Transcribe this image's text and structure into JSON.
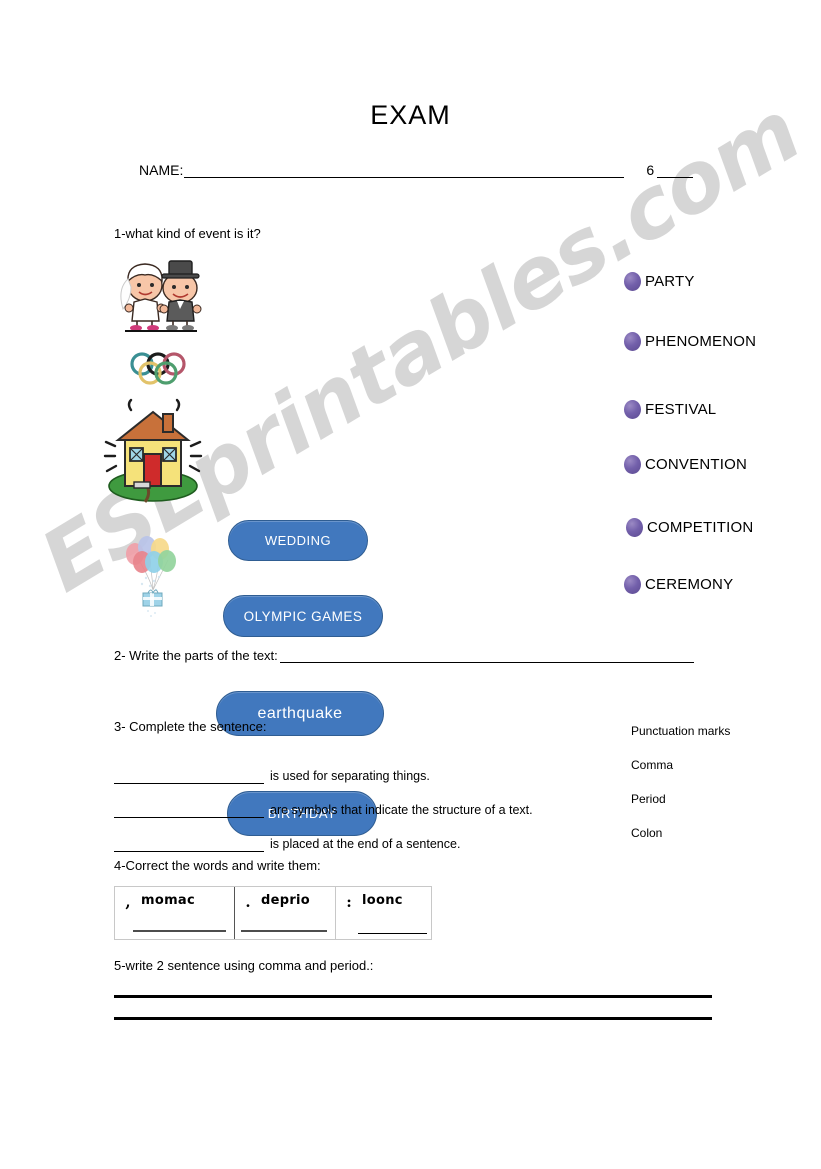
{
  "header": {
    "title": "EXAM",
    "name_label": "NAME:",
    "grade_label": "6"
  },
  "q1": {
    "prompt": "1-what kind of event is it?",
    "items": [
      {
        "image": "wedding-couple-clipart",
        "button_label": "WEDDING"
      },
      {
        "image": "olympic-rings-clipart",
        "button_label": "OLYMPIC GAMES"
      },
      {
        "image": "shaking-house-clipart",
        "button_label": "earthquake"
      },
      {
        "image": "balloons-gift-clipart",
        "button_label": "BIRTHDAY"
      }
    ],
    "options": [
      "PARTY",
      "PHENOMENON",
      "FESTIVAL",
      "CONVENTION",
      "COMPETITION",
      "CEREMONY"
    ]
  },
  "q2": {
    "prompt": "2- Write the parts of the text:"
  },
  "q3": {
    "prompt": "3- Complete the sentence:",
    "sentences": [
      "is used for separating things.",
      "are symbols that indicate the structure of a text.",
      "is placed at the end of a sentence."
    ],
    "wordbank": [
      "Punctuation marks",
      "Comma",
      "Period",
      "Colon"
    ]
  },
  "q4": {
    "prompt": "4-Correct the words and write them:",
    "cells": [
      {
        "mark": ",",
        "scrambled": "momac"
      },
      {
        "mark": ".",
        "scrambled": "deprio"
      },
      {
        "mark": ":",
        "scrambled": "loonc"
      }
    ]
  },
  "q5": {
    "prompt": "5-write 2 sentence using comma and period.:"
  },
  "watermark": {
    "text": "ESLprintables.com"
  },
  "colors": {
    "button_blue": "#4178be",
    "bullet_purple": "#7360ab",
    "page_background": "#ffffff"
  }
}
